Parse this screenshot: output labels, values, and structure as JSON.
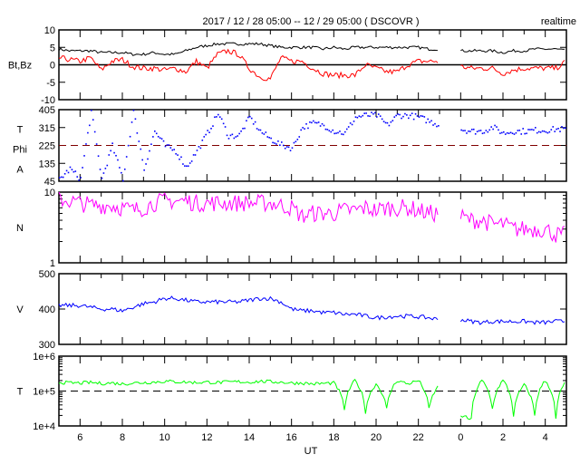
{
  "title": "2017 / 12 / 28   05:00 -- 12 / 29   05:00 ( DSCOVR )",
  "mode_label": "realtime",
  "chart_data": [
    {
      "type": "line",
      "panel": "magnetic-field",
      "ylabel": "Bt,Bz",
      "ylim": [
        -10,
        10
      ],
      "yticks": [
        "10",
        "5",
        "0",
        "-5",
        "-10"
      ],
      "reference_line": 0,
      "x_hours": [
        5,
        5.5,
        6,
        6.5,
        7,
        7.5,
        8,
        8.5,
        9,
        9.5,
        10,
        10.5,
        11,
        11.5,
        12,
        12.5,
        13,
        13.5,
        14,
        14.5,
        15,
        15.5,
        16,
        16.5,
        17,
        17.5,
        18,
        18.5,
        19,
        19.5,
        20,
        20.5,
        21,
        21.5,
        22,
        22.5,
        23,
        23.5,
        24,
        24.5,
        25,
        25.5,
        26,
        26.5,
        27,
        27.5,
        28,
        28.5,
        29
      ],
      "series": [
        {
          "name": "Bt",
          "color": "#000000",
          "values": [
            4.5,
            4,
            4,
            4,
            3.5,
            3.5,
            3.5,
            3,
            3,
            3.5,
            3,
            3,
            4,
            5,
            5.5,
            6,
            6,
            6,
            6,
            6,
            5.5,
            5,
            5,
            5,
            5,
            4.5,
            5,
            4.5,
            5,
            5,
            5,
            5,
            5,
            5,
            5,
            4.5,
            4.5,
            null,
            4,
            4,
            4,
            4,
            3.5,
            4,
            4,
            4.5,
            4.5,
            4.5,
            4
          ]
        },
        {
          "name": "Bz",
          "color": "#ff0000",
          "values": [
            2,
            1.5,
            1,
            2,
            -1.5,
            1,
            1.5,
            -0.5,
            -1,
            -1,
            -1.5,
            -1,
            -2,
            1,
            -1,
            3,
            4,
            3,
            -1,
            -3.5,
            -4,
            2,
            1,
            1,
            -1,
            -2.5,
            -3,
            -3,
            -3,
            0,
            -1,
            -2,
            -2,
            0,
            1,
            1,
            1,
            null,
            -0.5,
            -1,
            -1,
            -1,
            -2.5,
            -1.5,
            -1,
            -1,
            -1,
            -1,
            1
          ]
        }
      ]
    },
    {
      "type": "scatter",
      "panel": "phi-angle",
      "ylabel": [
        "T",
        "Phi",
        "A"
      ],
      "ylim": [
        45,
        405
      ],
      "yticks": [
        "405",
        "315",
        "225",
        "135",
        "45"
      ],
      "reference_line": 225,
      "series": [
        {
          "name": "Phi",
          "color": "#0000ff",
          "values": [
            60,
            110,
            60,
            400,
            60,
            225,
            60,
            400,
            110,
            300,
            225,
            200,
            120,
            200,
            290,
            390,
            275,
            280,
            370,
            300,
            260,
            230,
            215,
            320,
            340,
            330,
            300,
            290,
            370,
            380,
            380,
            330,
            380,
            380,
            370,
            350,
            330,
            null,
            310,
            300,
            300,
            320,
            290,
            300,
            300,
            305,
            305,
            310,
            310
          ]
        }
      ]
    },
    {
      "type": "line",
      "panel": "density",
      "ylabel": "N",
      "yscale": "log",
      "ylim": [
        1,
        10
      ],
      "yticks": [
        "10",
        "1"
      ],
      "series": [
        {
          "name": "N",
          "color": "#ff00ff",
          "values": [
            8,
            7.5,
            7,
            6.5,
            6.5,
            6.5,
            6,
            5.5,
            6,
            7,
            7.5,
            7.5,
            7.5,
            7,
            7,
            7,
            7,
            7,
            7,
            7,
            7,
            6.5,
            6,
            4.5,
            5,
            5,
            5,
            5.5,
            5.5,
            6,
            5.5,
            6,
            6,
            6,
            5.5,
            5,
            5,
            null,
            4.5,
            4,
            4,
            3.5,
            3.5,
            3,
            3,
            3,
            3,
            2.5,
            2.5
          ]
        }
      ]
    },
    {
      "type": "line",
      "panel": "velocity",
      "ylabel": "V",
      "ylim": [
        300,
        500
      ],
      "yticks": [
        "500",
        "400",
        "300"
      ],
      "series": [
        {
          "name": "V",
          "color": "#0000ff",
          "values": [
            410,
            410,
            410,
            405,
            400,
            400,
            395,
            405,
            415,
            420,
            430,
            430,
            425,
            420,
            420,
            420,
            420,
            420,
            425,
            430,
            430,
            420,
            400,
            395,
            395,
            390,
            390,
            385,
            385,
            380,
            375,
            378,
            380,
            380,
            378,
            375,
            370,
            null,
            370,
            365,
            362,
            365,
            365,
            365,
            365,
            362,
            362,
            365,
            365
          ]
        }
      ]
    },
    {
      "type": "line",
      "panel": "temperature",
      "ylabel": "T",
      "yscale": "log",
      "ylim": [
        10000,
        1000000
      ],
      "yticks": [
        "1e+6",
        "1e+5",
        "1e+4"
      ],
      "reference_line": 100000,
      "series": [
        {
          "name": "T",
          "color": "#00ff00",
          "values": [
            180000,
            170000,
            170000,
            175000,
            165000,
            170000,
            160000,
            170000,
            175000,
            180000,
            190000,
            185000,
            180000,
            175000,
            180000,
            175000,
            180000,
            185000,
            180000,
            190000,
            185000,
            180000,
            170000,
            170000,
            160000,
            165000,
            170000,
            30000,
            200000,
            25000,
            160000,
            30000,
            200000,
            160000,
            200000,
            30000,
            150000,
            null,
            20000,
            15000,
            200000,
            30000,
            200000,
            20000,
            150000,
            20000,
            200000,
            15000,
            200000
          ]
        }
      ]
    }
  ],
  "xaxis": {
    "label": "UT",
    "ticks": [
      "6",
      "8",
      "10",
      "12",
      "14",
      "16",
      "18",
      "20",
      "22",
      "0",
      "2",
      "4"
    ]
  }
}
